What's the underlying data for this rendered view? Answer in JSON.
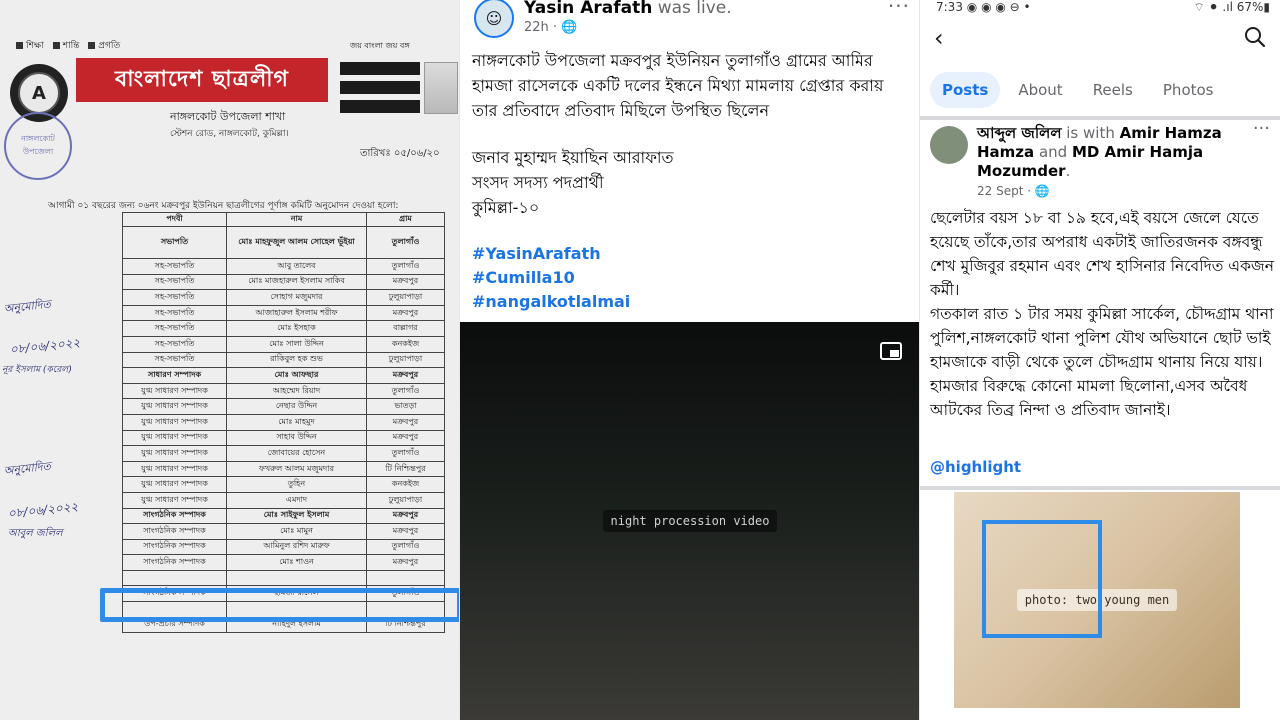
{
  "document": {
    "top_note": [
      "শিক্ষা",
      "শান্তি",
      "প্রগতি"
    ],
    "top_right_note": "জয় বাংলা  জয় বঙ্গ",
    "logo_letter": "A",
    "banner_title": "বাংলাদেশ ছাত্রলীগ",
    "subtitle": "নাঙ্গলকোট উপজেলা শাখা",
    "address": "স্টেশন রোড, নাঙ্গলকোট, কুমিল্লা।",
    "stamp_text": "নাঙ্গলকোট উপজেলা",
    "date_label": "তারিখঃ ০৫/০৬/২০",
    "intro": "আগামী ০১ বছরের জন্য ০৬নং মক্রবপুর ইউনিয়ন ছাত্রলীগের পূর্ণাঙ্গ কমিটি অনুমোদন দেওয়া হলো:",
    "columns": [
      "পদবী",
      "নাম",
      "গ্রাম"
    ],
    "rows": [
      {
        "post": "সভাপতি",
        "name": "মোঃ মাহফুজুল আলম সোহেল ভূঁইয়া",
        "village": "তুলাগাঁও",
        "bold": true,
        "tall": true
      },
      {
        "post": "সহ-সভাপতি",
        "name": "আবু তালেব",
        "village": "তুলাগাঁও"
      },
      {
        "post": "সহ-সভাপতি",
        "name": "মোঃ মাজহারুল ইসলাম সাকিব",
        "village": "মক্রবপুর"
      },
      {
        "post": "সহ-সভাপতি",
        "name": "সোহাগ মজুমদার",
        "village": "ঢুলুয়াপাড়া"
      },
      {
        "post": "সহ-সভাপতি",
        "name": "আজাহারুল ইসলাম শরীফ",
        "village": "মক্রবপুর"
      },
      {
        "post": "সহ-সভাপতি",
        "name": "মোঃ ইসহাক",
        "village": "বাল্লাগর"
      },
      {
        "post": "সহ-সভাপতি",
        "name": "মোঃ সালা উদ্দিন",
        "village": "কনকইজ"
      },
      {
        "post": "সহ-সভাপতি",
        "name": "রাকিবুল হক শুভ",
        "village": "ঢুলুয়াপাড়া"
      },
      {
        "post": "সাধারণ সম্পাদক",
        "name": "মোঃ আফছার",
        "village": "মক্রবপুর",
        "bold": true
      },
      {
        "post": "যুগ্ম সাধারণ সম্পাদক",
        "name": "আহম্মেদ রিয়াদ",
        "village": "তুলাগাঁও"
      },
      {
        "post": "যুগ্ম সাধারণ সম্পাদক",
        "name": "নেছার উদ্দিন",
        "village": "ভাতড়া"
      },
      {
        "post": "যুগ্ম সাধারণ সম্পাদক",
        "name": "মোঃ মাহমুদ",
        "village": "মক্রবপুর"
      },
      {
        "post": "যুগ্ম সাধারণ সম্পাদক",
        "name": "সাহাব উদ্দিন",
        "village": "মক্রবপুর"
      },
      {
        "post": "যুগ্ম সাধারণ সম্পাদক",
        "name": "জোবায়ের হোসেন",
        "village": "তুলাগাঁও"
      },
      {
        "post": "যুগ্ম সাধারণ সম্পাদক",
        "name": "ফখরুল আলম মজুমদার",
        "village": "টি নিশ্চিন্তপুর"
      },
      {
        "post": "যুগ্ম সাধারণ সম্পাদক",
        "name": "তুহিন",
        "village": "কনকইজ"
      },
      {
        "post": "যুগ্ম সাধারণ সম্পাদক",
        "name": "এমদাদ",
        "village": "ঢুলুয়াপাড়া"
      },
      {
        "post": "সাংগঠনিক সম্পাদক",
        "name": "মোঃ সাইফুল ইসলাম",
        "village": "মক্রবপুর",
        "bold": true
      },
      {
        "post": "সাংগঠনিক সম্পাদক",
        "name": "মোঃ মামুন",
        "village": "মক্রবপুর"
      },
      {
        "post": "সাংগঠনিক সম্পাদক",
        "name": "আমিনুল রশিদ মারুফ",
        "village": "তুলাগাঁও"
      },
      {
        "post": "সাংগঠনিক সম্পাদক",
        "name": "মোঃ শাওন",
        "village": "মক্রবপুর"
      },
      {
        "post": "",
        "name": "",
        "village": ""
      },
      {
        "post": "সাংগঠনিক সম্পাদক",
        "name": "হামজা রাসেল",
        "village": "তুলাগাঁও"
      },
      {
        "post": "",
        "name": "",
        "village": ""
      },
      {
        "post": "উপ-প্রচার সম্পাদক",
        "name": "নাহিদুল ইসলাম",
        "village": "টি নিশ্চিন্তপুর"
      }
    ],
    "signatures": [
      "অনুমোদিত",
      "০৮/০৬/২০২২",
      "নূর ইসলাম (করেল)",
      "অনুমোদিত",
      "০৮/০৬/২০২২",
      "আবুল জলিল"
    ]
  },
  "live_post": {
    "author": "Yasin Arafath",
    "status": " was live.",
    "time": "22h · 🌐",
    "more": "···",
    "text_lines": [
      "নাঙ্গলকোট উপজেলা মক্রবপুর ইউনিয়ন তুলাগাঁও গ্রামের আমির হামজা রাসেলকে একটি দলের ইন্ধনে মিথ্যা মামলায় গ্রেপ্তার করায় তার প্রতিবাদে প্রতিবাদ মিছিলে উপস্থিত ছিলেন",
      "জনাব মুহাম্মদ ইয়াছিন আরাফাত",
      "সংসদ সদস্য পদপ্রার্থী",
      "কুমিল্লা-১০"
    ],
    "hashtags": [
      "#YasinArafath",
      "#Cumilla10",
      "#nangalkotlalmai"
    ],
    "video_label": "night procession video"
  },
  "profile_post": {
    "status_time": "7:33",
    "status_icons": "◉ ◉ ◉ ⊖ •",
    "status_right": "⌔ ⚫ .ıl 67%▮",
    "tabs": [
      "Posts",
      "About",
      "Reels",
      "Photos"
    ],
    "author": "আব্দুল জলিল",
    "with_text": " is with ",
    "with_name1": "Amir Hamza Hamza",
    "and_text": " and ",
    "with_name2": "MD Amir Hamja Mozumder",
    "period": ".",
    "date": "22 Sept · 🌐",
    "more": "···",
    "body_lines": [
      "ছেলেটার বয়স ১৮ বা ১৯ হবে,এই বয়সে জেলে যেতে হয়েছে তাঁকে,তার অপরাধ একটাই জাতিরজনক বঙ্গবন্ধু শেখ মুজিবুর রহমান এবং শেখ হাসিনার নিবেদিত একজন কর্মী।",
      "গতকাল রাত ১ টার সময় কুমিল্লা সার্কেল, চৌদ্দগ্রাম থানা পুলিশ,নাঙ্গলকোট থানা পুলিশ  যৌথ অভিযানে ছোট ভাই হামজাকে বাড়ী থেকে তুলে চৌদ্দগ্রাম থানায় নিয়ে যায়।",
      "হামজার বিরুদ্ধে কোনো মামলা ছিলোনা,এসব অবৈধ আটকের তিব্র নিন্দা ও প্রতিবাদ জানাই।"
    ],
    "hashtag": "@highlight",
    "photo_label": "photo: two young men"
  },
  "colors": {
    "fb_blue": "#1b74e4",
    "banner_red": "#c3252a",
    "highlight_blue": "#2e8ce8"
  }
}
